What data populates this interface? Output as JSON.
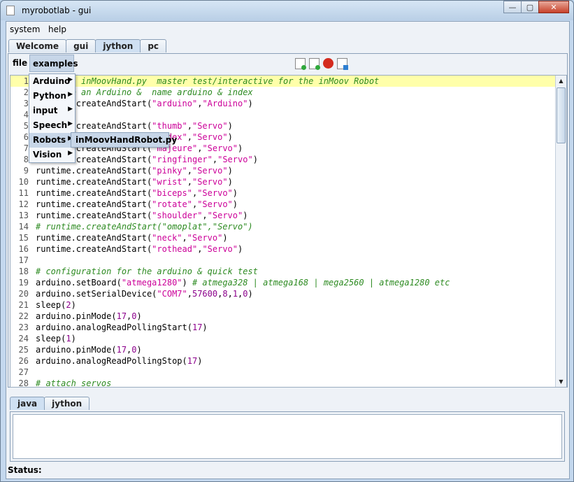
{
  "window": {
    "title": "myrobotlab - gui"
  },
  "menubar": {
    "items": [
      "system",
      "help"
    ]
  },
  "top_tabs": [
    {
      "label": "Welcome",
      "active": false
    },
    {
      "label": "gui",
      "active": false
    },
    {
      "label": "jython",
      "active": true
    },
    {
      "label": "pc",
      "active": false
    }
  ],
  "editor_menu": {
    "file": "file",
    "examples": "examples"
  },
  "examples_menu": {
    "items": [
      "Arduino",
      "Python",
      "input",
      "Speech",
      "Robots",
      "Vision"
    ],
    "selected": "Robots",
    "submenu_item": "inMoovHandRobot.py"
  },
  "code_lines": [
    {
      "n": "1",
      "parts": [
        [
          "cm",
          "# file : inMoovHand.py  master test/interactive for the inMoov Robot"
        ]
      ]
    },
    {
      "n": "2",
      "parts": [
        [
          "cm",
          "# create an Arduino &  name arduino & index"
        ]
      ]
    },
    {
      "n": "3",
      "parts": [
        [
          "tx",
          "runtime.createAndStart("
        ],
        [
          "st",
          "\"arduino\""
        ],
        [
          "tx",
          ","
        ],
        [
          "st",
          "\"Arduino\""
        ],
        [
          "tx",
          ")"
        ]
      ]
    },
    {
      "n": "4",
      "parts": []
    },
    {
      "n": "5",
      "parts": [
        [
          "tx",
          "runtime.createAndStart("
        ],
        [
          "st",
          "\"thumb\""
        ],
        [
          "tx",
          ","
        ],
        [
          "st",
          "\"Servo\""
        ],
        [
          "tx",
          ")"
        ]
      ]
    },
    {
      "n": "6",
      "parts": [
        [
          "tx",
          "runtime.createAndStart("
        ],
        [
          "st",
          "\"index\""
        ],
        [
          "tx",
          ","
        ],
        [
          "st",
          "\"Servo\""
        ],
        [
          "tx",
          ")"
        ]
      ]
    },
    {
      "n": "7",
      "parts": [
        [
          "tx",
          "runtime.createAndStart("
        ],
        [
          "st",
          "\"majeure\""
        ],
        [
          "tx",
          ","
        ],
        [
          "st",
          "\"Servo\""
        ],
        [
          "tx",
          ")"
        ]
      ]
    },
    {
      "n": "8",
      "parts": [
        [
          "tx",
          "runtime.createAndStart("
        ],
        [
          "st",
          "\"ringfinger\""
        ],
        [
          "tx",
          ","
        ],
        [
          "st",
          "\"Servo\""
        ],
        [
          "tx",
          ")"
        ]
      ]
    },
    {
      "n": "9",
      "parts": [
        [
          "tx",
          "runtime.createAndStart("
        ],
        [
          "st",
          "\"pinky\""
        ],
        [
          "tx",
          ","
        ],
        [
          "st",
          "\"Servo\""
        ],
        [
          "tx",
          ")"
        ]
      ]
    },
    {
      "n": "10",
      "parts": [
        [
          "tx",
          "runtime.createAndStart("
        ],
        [
          "st",
          "\"wrist\""
        ],
        [
          "tx",
          ","
        ],
        [
          "st",
          "\"Servo\""
        ],
        [
          "tx",
          ")"
        ]
      ]
    },
    {
      "n": "11",
      "parts": [
        [
          "tx",
          "runtime.createAndStart("
        ],
        [
          "st",
          "\"biceps\""
        ],
        [
          "tx",
          ","
        ],
        [
          "st",
          "\"Servo\""
        ],
        [
          "tx",
          ")"
        ]
      ]
    },
    {
      "n": "12",
      "parts": [
        [
          "tx",
          "runtime.createAndStart("
        ],
        [
          "st",
          "\"rotate\""
        ],
        [
          "tx",
          ","
        ],
        [
          "st",
          "\"Servo\""
        ],
        [
          "tx",
          ")"
        ]
      ]
    },
    {
      "n": "13",
      "parts": [
        [
          "tx",
          "runtime.createAndStart("
        ],
        [
          "st",
          "\"shoulder\""
        ],
        [
          "tx",
          ","
        ],
        [
          "st",
          "\"Servo\""
        ],
        [
          "tx",
          ")"
        ]
      ]
    },
    {
      "n": "14",
      "parts": [
        [
          "cm",
          "# runtime.createAndStart(\"omoplat\",\"Servo\")"
        ]
      ]
    },
    {
      "n": "15",
      "parts": [
        [
          "tx",
          "runtime.createAndStart("
        ],
        [
          "st",
          "\"neck\""
        ],
        [
          "tx",
          ","
        ],
        [
          "st",
          "\"Servo\""
        ],
        [
          "tx",
          ")"
        ]
      ]
    },
    {
      "n": "16",
      "parts": [
        [
          "tx",
          "runtime.createAndStart("
        ],
        [
          "st",
          "\"rothead\""
        ],
        [
          "tx",
          ","
        ],
        [
          "st",
          "\"Servo\""
        ],
        [
          "tx",
          ")"
        ]
      ]
    },
    {
      "n": "17",
      "parts": []
    },
    {
      "n": "18",
      "parts": [
        [
          "cm",
          "# configuration for the arduino & quick test"
        ]
      ]
    },
    {
      "n": "19",
      "parts": [
        [
          "tx",
          "arduino.setBoard("
        ],
        [
          "st",
          "\"atmega1280\""
        ],
        [
          "tx",
          ") "
        ],
        [
          "cm",
          "# atmega328 | atmega168 | mega2560 | atmega1280 etc"
        ]
      ]
    },
    {
      "n": "20",
      "parts": [
        [
          "tx",
          "arduino.setSerialDevice("
        ],
        [
          "st",
          "\"COM7\""
        ],
        [
          "tx",
          ","
        ],
        [
          "nm",
          "57600"
        ],
        [
          "tx",
          ","
        ],
        [
          "nm",
          "8"
        ],
        [
          "tx",
          ","
        ],
        [
          "nm",
          "1"
        ],
        [
          "tx",
          ","
        ],
        [
          "nm",
          "0"
        ],
        [
          "tx",
          ")"
        ]
      ]
    },
    {
      "n": "21",
      "parts": [
        [
          "tx",
          "sleep("
        ],
        [
          "nm",
          "2"
        ],
        [
          "tx",
          ")"
        ]
      ]
    },
    {
      "n": "22",
      "parts": [
        [
          "tx",
          "arduino.pinMode("
        ],
        [
          "nm",
          "17"
        ],
        [
          "tx",
          ","
        ],
        [
          "nm",
          "0"
        ],
        [
          "tx",
          ")"
        ]
      ]
    },
    {
      "n": "23",
      "parts": [
        [
          "tx",
          "arduino.analogReadPollingStart("
        ],
        [
          "nm",
          "17"
        ],
        [
          "tx",
          ")"
        ]
      ]
    },
    {
      "n": "24",
      "parts": [
        [
          "tx",
          "sleep("
        ],
        [
          "nm",
          "1"
        ],
        [
          "tx",
          ")"
        ]
      ]
    },
    {
      "n": "25",
      "parts": [
        [
          "tx",
          "arduino.pinMode("
        ],
        [
          "nm",
          "17"
        ],
        [
          "tx",
          ","
        ],
        [
          "nm",
          "0"
        ],
        [
          "tx",
          ")"
        ]
      ]
    },
    {
      "n": "26",
      "parts": [
        [
          "tx",
          "arduino.analogReadPollingStop("
        ],
        [
          "nm",
          "17"
        ],
        [
          "tx",
          ")"
        ]
      ]
    },
    {
      "n": "27",
      "parts": []
    },
    {
      "n": "28",
      "parts": [
        [
          "cm",
          "# attach servos"
        ]
      ]
    }
  ],
  "bottom_tabs": [
    {
      "label": "java",
      "active": true
    },
    {
      "label": "jython",
      "active": false
    }
  ],
  "status": {
    "label": "Status:"
  },
  "colors": {
    "comment": "#2e8b22",
    "string": "#cc0099",
    "number": "#8b008b",
    "highlight": "#ffffaa"
  },
  "icons": [
    "new-file-icon",
    "open-file-icon",
    "record-icon",
    "save-icon"
  ]
}
